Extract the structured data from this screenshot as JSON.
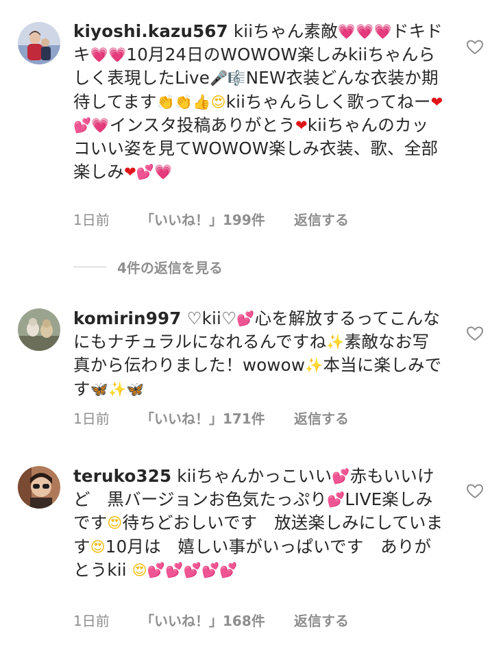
{
  "comments": [
    {
      "username": "kiyoshi.kazu567",
      "time": "1日前",
      "likes": "「いいね！」199件",
      "reply": "返信する",
      "segments": [
        {
          "t": "kiiちゃん素敵"
        },
        {
          "e": "heart",
          "g": "💗"
        },
        {
          "e": "heart",
          "g": "💗"
        },
        {
          "e": "heart",
          "g": "💗"
        },
        {
          "t": "ドキドキ"
        },
        {
          "e": "heart",
          "g": "💗"
        },
        {
          "e": "heart",
          "g": "💗"
        },
        {
          "t": "10月24日のWOWOW楽しみkiiちゃんらしく表現したLive"
        },
        {
          "e": "dark",
          "g": "🎤"
        },
        {
          "e": "dark",
          "g": "🎼"
        },
        {
          "t": "NEW衣装どんな衣装か期待してます"
        },
        {
          "e": "hands",
          "g": "👏"
        },
        {
          "e": "hands",
          "g": "👏"
        },
        {
          "e": "hands",
          "g": "👍"
        },
        {
          "e": "face",
          "g": "😍"
        },
        {
          "t": "kiiちゃんらしく歌ってねー"
        },
        {
          "e": "red",
          "g": "❤"
        },
        {
          "e": "heart",
          "g": "💕"
        },
        {
          "e": "heart",
          "g": "💗"
        },
        {
          "t": "インスタ投稿ありがとう"
        },
        {
          "e": "red",
          "g": "❤"
        },
        {
          "t": "kiiちゃんのカッコいい姿を見てWOWOW楽しみ衣装、歌、全部楽しみ"
        },
        {
          "e": "red",
          "g": "❤"
        },
        {
          "e": "heart",
          "g": "💕"
        },
        {
          "e": "heart",
          "g": "💗"
        }
      ]
    },
    {
      "username": "komirin997",
      "time": "1日前",
      "likes": "「いいね！」171件",
      "reply": "返信する",
      "segments": [
        {
          "t": "♡kii♡"
        },
        {
          "e": "heart",
          "g": "💕"
        },
        {
          "t": "心を解放するってこんなにもナチュラルになれるんですね"
        },
        {
          "e": "spark",
          "g": "✨"
        },
        {
          "t": "素敵なお写真から伝わりました！wowow"
        },
        {
          "e": "spark",
          "g": "✨"
        },
        {
          "t": "本当に楽しみです"
        },
        {
          "e": "blue",
          "g": "🦋"
        },
        {
          "e": "spark",
          "g": "✨"
        },
        {
          "e": "blue",
          "g": "🦋"
        }
      ]
    },
    {
      "username": "teruko325",
      "time": "1日前",
      "likes": "「いいね！」168件",
      "reply": "返信する",
      "segments": [
        {
          "t": "kiiちゃんかっこいい"
        },
        {
          "e": "heart",
          "g": "💕"
        },
        {
          "t": "赤もいいけど　黒バージョンお色気たっぷり"
        },
        {
          "e": "heart",
          "g": "💕"
        },
        {
          "t": "LIVE楽しみです"
        },
        {
          "e": "face",
          "g": "😍"
        },
        {
          "t": "待ちどおしいです　放送楽しみにしています"
        },
        {
          "e": "face",
          "g": "😍"
        },
        {
          "t": "10月は　嬉しい事がいっぱいです　ありがとうkii "
        },
        {
          "e": "face",
          "g": "😍"
        },
        {
          "e": "heart",
          "g": "💕"
        },
        {
          "e": "heart",
          "g": "💕"
        },
        {
          "e": "heart",
          "g": "💕"
        },
        {
          "e": "heart",
          "g": "💕"
        },
        {
          "e": "heart",
          "g": "💕"
        }
      ]
    }
  ],
  "view_replies": "4件の返信を見る",
  "colors": {
    "text": "#262626",
    "meta": "#8e8e8e",
    "heart_pink": "#ff3aa0",
    "heart_red": "#e0151a"
  }
}
